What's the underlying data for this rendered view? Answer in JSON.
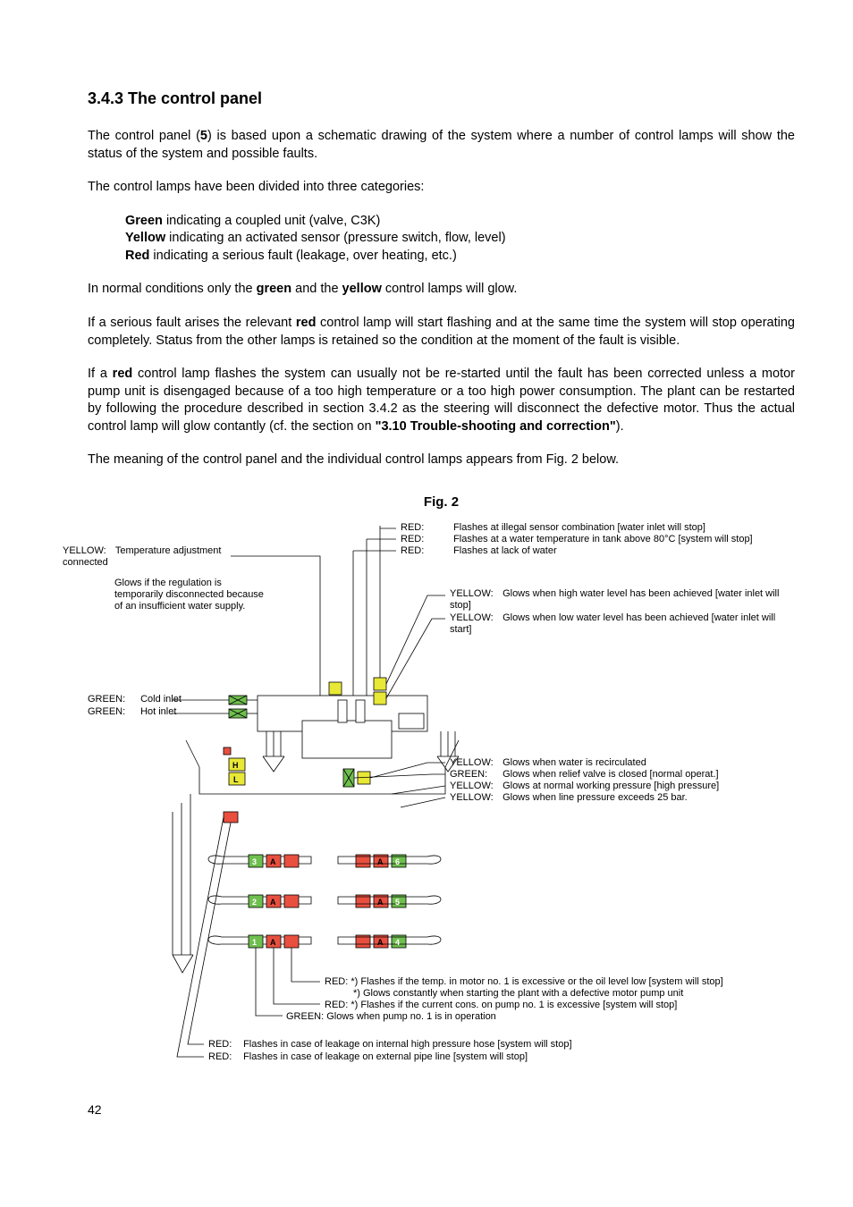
{
  "heading": "3.4.3  The control panel",
  "p1_a": "The control panel (",
  "p1_b": "5",
  "p1_c": ") is based upon a schematic drawing of the system where a number of control lamps will show the status of the system and possible faults.",
  "p2": "The control lamps have been divided into three categories:",
  "li1_a": "Green",
  "li1_b": " indicating a coupled unit (valve, C3K)",
  "li2_a": "Yellow",
  "li2_b": " indicating an activated sensor (pressure switch, flow, level)",
  "li3_a": "Red",
  "li3_b": " indicating a serious fault (leakage, over heating, etc.)",
  "p3_a": "In normal conditions only the ",
  "p3_b": "green",
  "p3_c": " and the ",
  "p3_d": "yellow",
  "p3_e": " control lamps will glow.",
  "p4_a": "If a serious fault arises the relevant ",
  "p4_b": "red",
  "p4_c": " control lamp will start flashing and at the same time the system will stop operating completely. Status from the other lamps is retained so the condition at the moment of the fault is visible.",
  "p5_a": "If a ",
  "p5_b": "red",
  "p5_c": " control lamp flashes the system can usually not be re-started until the fault has been corrected unless a motor pump unit is disengaged because of a too high temperature or a too high power consumption. The plant can be restarted by following the procedure described in section 3.4.2 as the steering will disconnect the defective motor. Thus the actual control lamp will glow contantly (cf. the section on ",
  "p5_d": "\"3.10 Trouble-shooting and correction\"",
  "p5_e": ").",
  "p6": "The meaning of the control panel and the individual control lamps appears from Fig. 2 below.",
  "fig_title": "Fig. 2",
  "annot": {
    "top_red1_k": "RED:",
    "top_red1_v": "Flashes at illegal sensor combination [water inlet will stop]",
    "top_red2_k": "RED:",
    "top_red2_v": "Flashes at a water temperature in tank above 80°C [system will stop]",
    "top_red3_k": "RED:",
    "top_red3_v": "Flashes at lack of water",
    "left_yellow_k": "YELLOW:",
    "left_yellow_v": "Temperature adjustment connected",
    "left_sub": "Glows if the regulation is temporarily disconnected because of an insufficient water supply.",
    "mid_yel1_k": "YELLOW:",
    "mid_yel1_v": "Glows when high water level has been achieved [water inlet will stop]",
    "mid_yel2_k": "YELLOW:",
    "mid_yel2_v": "Glows when low water level has been achieved [water inlet will start]",
    "left_grn1_k": "GREEN:",
    "left_grn1_v": "Cold inlet",
    "left_grn2_k": "GREEN:",
    "left_grn2_v": "Hot inlet",
    "center_y1_k": "YELLOW:",
    "center_y1_v": "Glows when water is recirculated",
    "center_g1_k": "GREEN:",
    "center_g1_v": "Glows when relief valve is closed [normal operat.]",
    "center_y2_k": "YELLOW:",
    "center_y2_v": "Glows at normal working pressure [high pressure]",
    "center_y3_k": "YELLOW:",
    "center_y3_v": "Glows when line pressure exceeds 25 bar.",
    "btm_red1_k": "RED:",
    "btm_red1_v": "*) Flashes if the temp. in motor no. 1 is excessive or the oil level low [system will stop]",
    "btm_red1_sub": "*) Glows constantly when starting the plant with a defective motor pump unit",
    "btm_red2_k": "RED:",
    "btm_red2_v": "*) Flashes if the current cons. on pump no. 1 is excessive [system will stop]",
    "btm_grn_k": "GREEN:",
    "btm_grn_v": "Glows when pump no. 1 is in operation",
    "btm_red3_k": "RED:",
    "btm_red3_v": "Flashes in case of leakage on internal high pressure hose [system will stop]",
    "btm_red4_k": "RED:",
    "btm_red4_v": "Flashes in case of leakage on external pipe line [system will stop]"
  },
  "schematic": {
    "H": "H",
    "L": "L",
    "A": "A",
    "nums": [
      "1",
      "2",
      "3",
      "4",
      "5",
      "6"
    ]
  },
  "page_number": "42"
}
